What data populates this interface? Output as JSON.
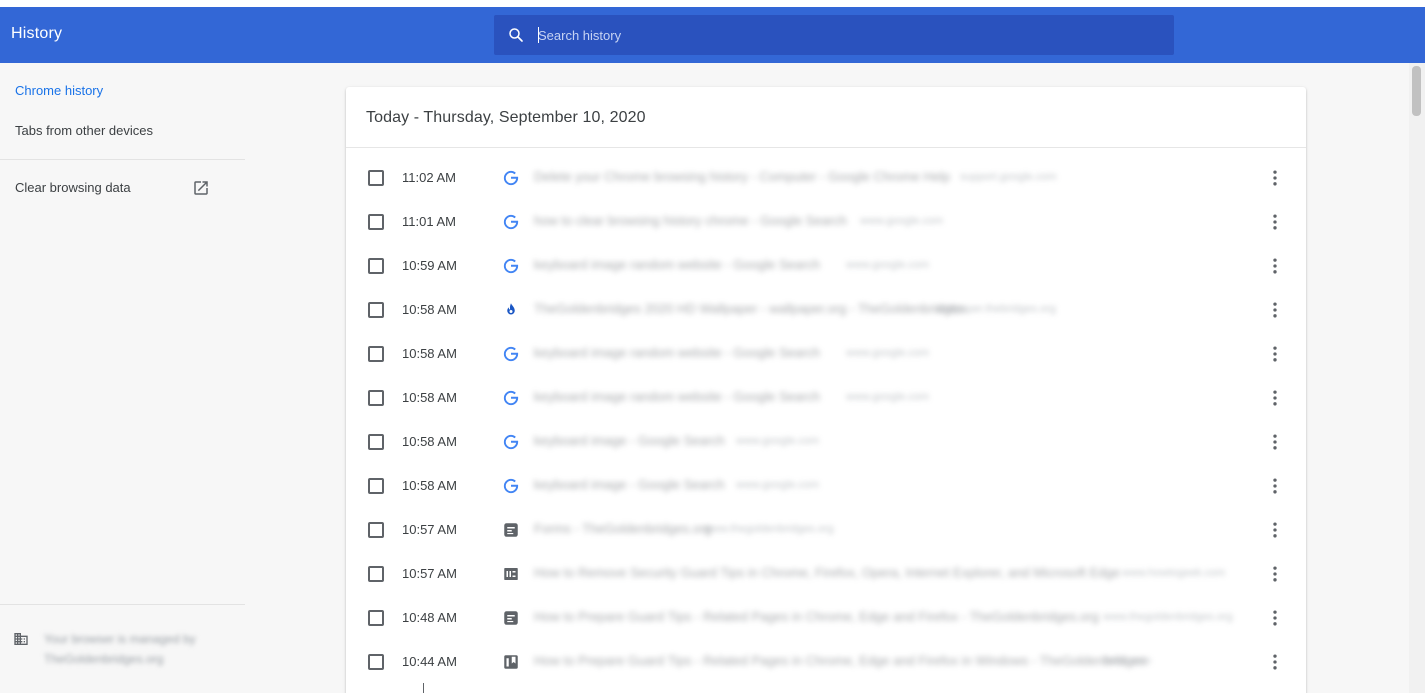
{
  "toolbar": {
    "title": "History",
    "search_placeholder": "Search history",
    "search_value": ""
  },
  "sidebar": {
    "items": [
      {
        "label": "Chrome history",
        "active": true
      },
      {
        "label": "Tabs from other devices",
        "active": false
      },
      {
        "label": "Clear browsing data",
        "active": false
      }
    ],
    "managed_text": "Your browser is managed by TheGoldenbridges.org"
  },
  "history": {
    "day_header": "Today - Thursday, September 10, 2020",
    "entries": [
      {
        "time": "11:02 AM",
        "icon": "google-icon",
        "title": "Delete your Chrome browsing history - Computer - Google Chrome Help",
        "domain": "support.google.com"
      },
      {
        "time": "11:01 AM",
        "icon": "google-icon",
        "title": "how to clear browsing history chrome - Google Search",
        "domain": "www.google.com"
      },
      {
        "time": "10:59 AM",
        "icon": "google-icon",
        "title": "keyboard image random website - Google Search",
        "domain": "www.google.com"
      },
      {
        "time": "10:58 AM",
        "icon": "blue-flame-icon",
        "title": "TheGoldenbridges 2020 HD Wallpaper - wallpaper.org - TheGoldenbridges",
        "domain": "wallpaper.thebridges.org"
      },
      {
        "time": "10:58 AM",
        "icon": "google-icon",
        "title": "keyboard image random website - Google Search",
        "domain": "www.google.com"
      },
      {
        "time": "10:58 AM",
        "icon": "google-icon",
        "title": "keyboard image random website - Google Search",
        "domain": "www.google.com"
      },
      {
        "time": "10:58 AM",
        "icon": "google-icon",
        "title": "keyboard image - Google Search",
        "domain": "www.google.com"
      },
      {
        "time": "10:58 AM",
        "icon": "google-icon",
        "title": "keyboard image - Google Search",
        "domain": "www.google.com"
      },
      {
        "time": "10:57 AM",
        "icon": "document-icon",
        "title": "Forms - TheGoldenbridges.org",
        "domain": "www.thegoldenbridges.org"
      },
      {
        "time": "10:57 AM",
        "icon": "site-logo-icon",
        "title": "How to Remove Security Guard Tips in Chrome, Firefox, Opera, Internet Explorer, and Microsoft Edge",
        "domain": "www.howtogeek.com"
      },
      {
        "time": "10:48 AM",
        "icon": "document-icon",
        "title": "How to Prepare Guard Tips - Related Pages in Chrome, Edge and Firefox - TheGoldenbridges.org",
        "domain": "www.thegoldenbridges.org"
      },
      {
        "time": "10:44 AM",
        "icon": "bookmark-icon",
        "title": "How to Prepare Guard Tips - Related Pages in Chrome, Edge and Firefox in Windows - TheGoldenbridges",
        "domain": "hello.com"
      }
    ]
  },
  "colors": {
    "toolbar_bg": "#3367d6",
    "search_bg": "#2a52be",
    "active_nav": "#1a73e8",
    "card_bg": "#ffffff",
    "page_bg": "#f7f7f7"
  }
}
